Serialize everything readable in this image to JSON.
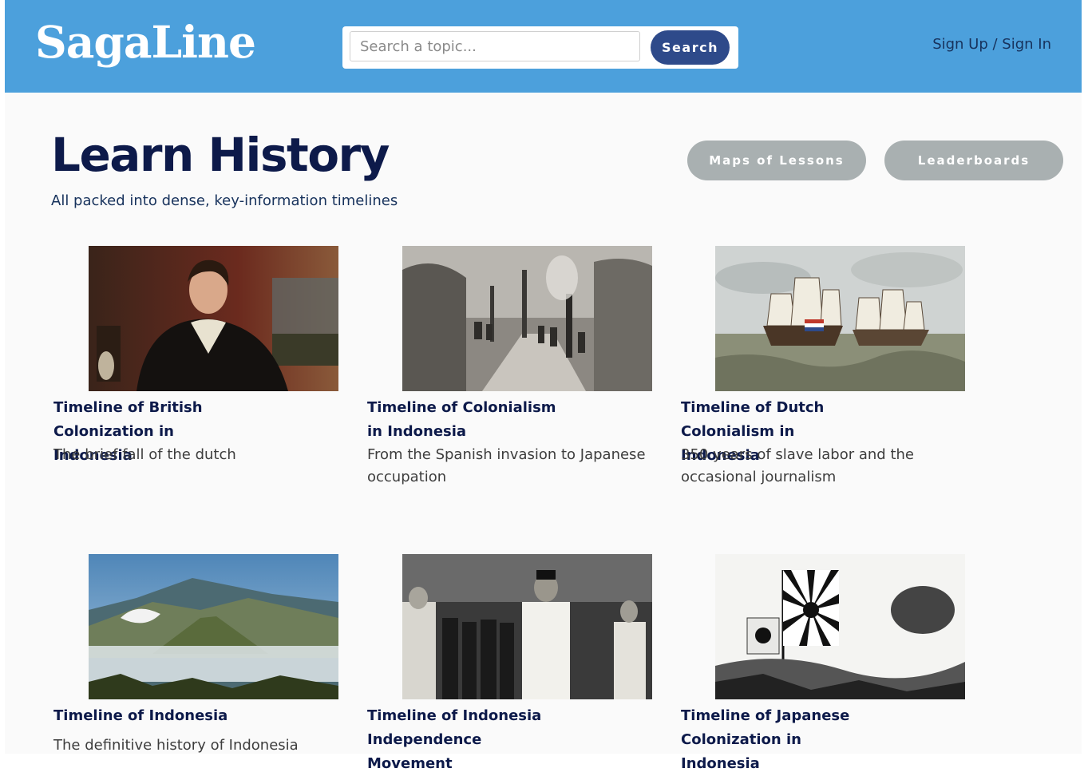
{
  "header": {
    "logo": "SagaLine",
    "search_placeholder": "Search a topic...",
    "search_button": "Search",
    "auth_link": "Sign Up / Sign In"
  },
  "hero": {
    "title": "Learn History",
    "subtitle": "All packed into dense, key-information timelines",
    "buttons": [
      "Maps of Lessons",
      "Leaderboards"
    ]
  },
  "cards": [
    {
      "title": "Timeline of British Colonization in Indonesia",
      "description": "The brief fall of the dutch",
      "image": "portrait-painting"
    },
    {
      "title": "Timeline of Colonialism in Indonesia",
      "description": "From the Spanish invasion to Japanese occupation",
      "image": "forest-road-photo"
    },
    {
      "title": "Timeline of Dutch Colonialism in Indonesia",
      "description": "350 years of slave labor and the occasional journalism",
      "image": "sailing-ships-painting"
    },
    {
      "title": "Timeline of Indonesia",
      "description": "The definitive history of Indonesia",
      "image": "volcano-landscape"
    },
    {
      "title": "Timeline of Indonesia Independence Movement",
      "description": "",
      "image": "proclamation-photo"
    },
    {
      "title": "Timeline of Japanese Colonization in Indonesia",
      "description": "",
      "image": "rising-sun-flag-photo"
    }
  ]
}
